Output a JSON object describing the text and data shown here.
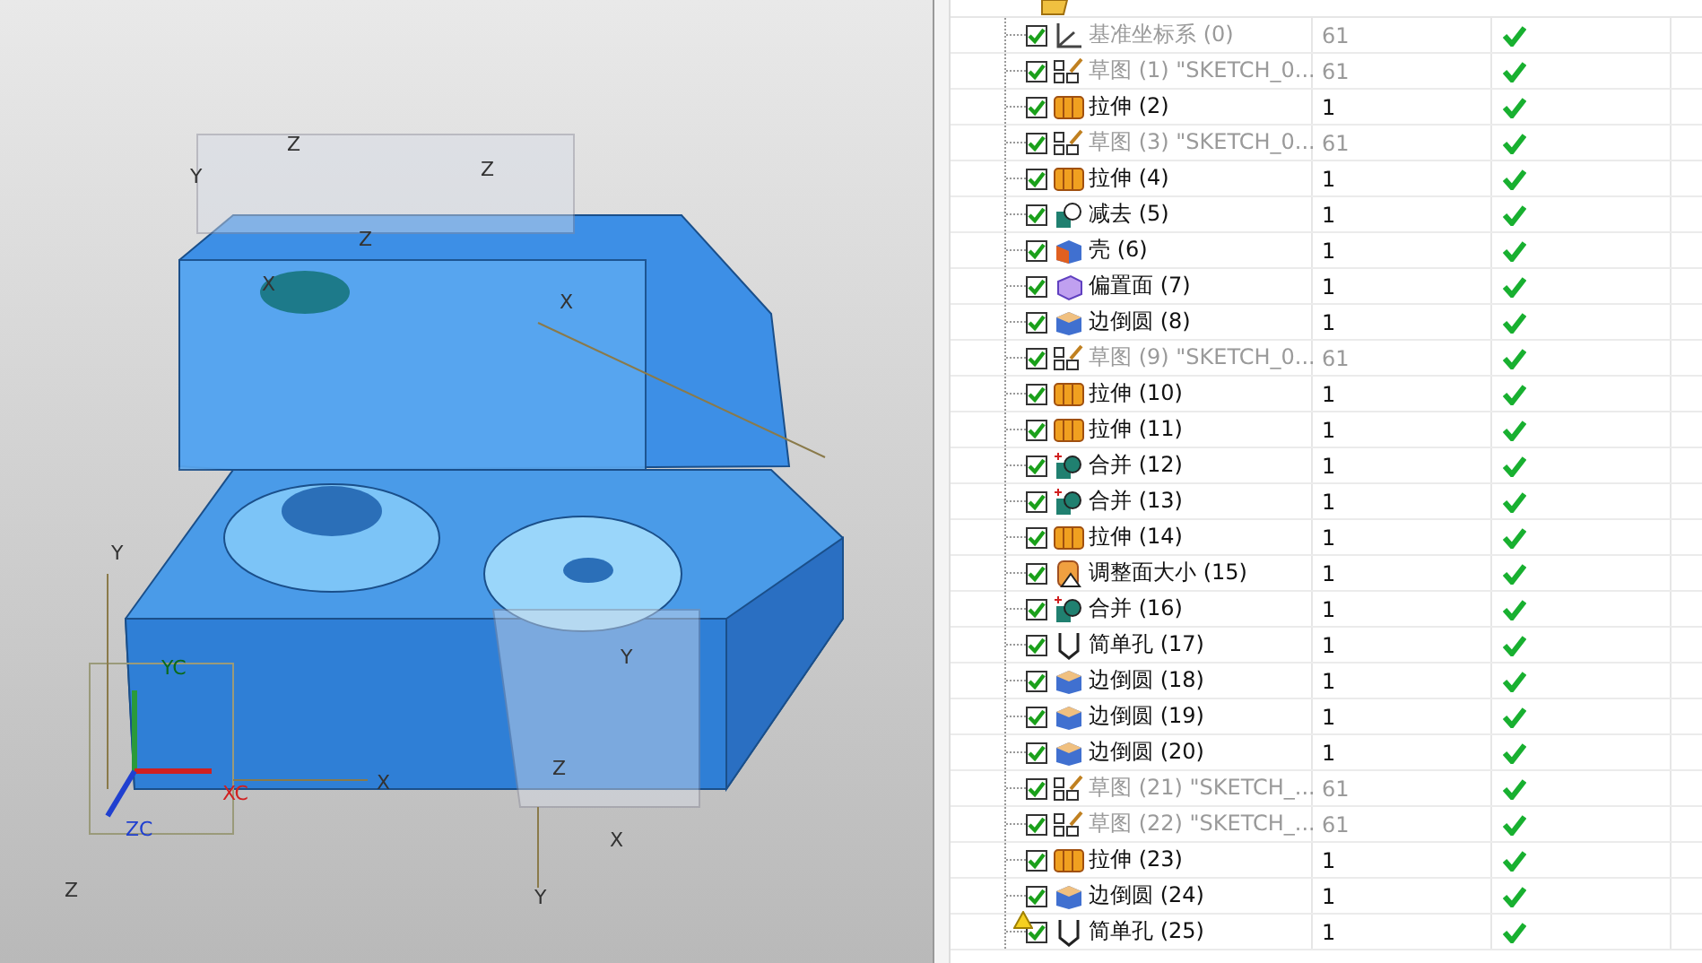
{
  "viewport": {
    "axis_labels": [
      "Z",
      "Y",
      "Z",
      "X",
      "X",
      "Y",
      "YC",
      "XC",
      "ZC",
      "Z",
      "X",
      "Z",
      "Y",
      "X",
      "Y",
      "Z"
    ]
  },
  "part_navigator": {
    "rows": [
      {
        "name": "基准坐标系 (0)",
        "kind": "datum",
        "dimmed": true,
        "checked": true,
        "warning": false,
        "layer": "61",
        "up_to_date": true
      },
      {
        "name": "草图 (1) \"SKETCH_0...",
        "kind": "sketch",
        "dimmed": true,
        "checked": true,
        "warning": false,
        "layer": "61",
        "up_to_date": true
      },
      {
        "name": "拉伸 (2)",
        "kind": "extrude",
        "dimmed": false,
        "checked": true,
        "warning": false,
        "layer": "1",
        "up_to_date": true
      },
      {
        "name": "草图 (3) \"SKETCH_0...",
        "kind": "sketch",
        "dimmed": true,
        "checked": true,
        "warning": false,
        "layer": "61",
        "up_to_date": true
      },
      {
        "name": "拉伸 (4)",
        "kind": "extrude",
        "dimmed": false,
        "checked": true,
        "warning": false,
        "layer": "1",
        "up_to_date": true
      },
      {
        "name": "减去 (5)",
        "kind": "subtract",
        "dimmed": false,
        "checked": true,
        "warning": false,
        "layer": "1",
        "up_to_date": true
      },
      {
        "name": "壳 (6)",
        "kind": "shell",
        "dimmed": false,
        "checked": true,
        "warning": false,
        "layer": "1",
        "up_to_date": true
      },
      {
        "name": "偏置面 (7)",
        "kind": "offset",
        "dimmed": false,
        "checked": true,
        "warning": false,
        "layer": "1",
        "up_to_date": true
      },
      {
        "name": "边倒圆 (8)",
        "kind": "blend",
        "dimmed": false,
        "checked": true,
        "warning": false,
        "layer": "1",
        "up_to_date": true
      },
      {
        "name": "草图 (9) \"SKETCH_0...",
        "kind": "sketch",
        "dimmed": true,
        "checked": true,
        "warning": false,
        "layer": "61",
        "up_to_date": true
      },
      {
        "name": "拉伸 (10)",
        "kind": "extrude",
        "dimmed": false,
        "checked": true,
        "warning": false,
        "layer": "1",
        "up_to_date": true
      },
      {
        "name": "拉伸 (11)",
        "kind": "extrude",
        "dimmed": false,
        "checked": true,
        "warning": false,
        "layer": "1",
        "up_to_date": true
      },
      {
        "name": "合并 (12)",
        "kind": "unite",
        "dimmed": false,
        "checked": true,
        "warning": false,
        "layer": "1",
        "up_to_date": true
      },
      {
        "name": "合并 (13)",
        "kind": "unite",
        "dimmed": false,
        "checked": true,
        "warning": false,
        "layer": "1",
        "up_to_date": true
      },
      {
        "name": "拉伸 (14)",
        "kind": "extrude",
        "dimmed": false,
        "checked": true,
        "warning": false,
        "layer": "1",
        "up_to_date": true
      },
      {
        "name": "调整面大小 (15)",
        "kind": "resize",
        "dimmed": false,
        "checked": true,
        "warning": false,
        "layer": "1",
        "up_to_date": true
      },
      {
        "name": "合并 (16)",
        "kind": "unite",
        "dimmed": false,
        "checked": true,
        "warning": false,
        "layer": "1",
        "up_to_date": true
      },
      {
        "name": "简单孔 (17)",
        "kind": "hole",
        "dimmed": false,
        "checked": true,
        "warning": false,
        "layer": "1",
        "up_to_date": true
      },
      {
        "name": "边倒圆 (18)",
        "kind": "blend",
        "dimmed": false,
        "checked": true,
        "warning": false,
        "layer": "1",
        "up_to_date": true
      },
      {
        "name": "边倒圆 (19)",
        "kind": "blend",
        "dimmed": false,
        "checked": true,
        "warning": false,
        "layer": "1",
        "up_to_date": true
      },
      {
        "name": "边倒圆 (20)",
        "kind": "blend",
        "dimmed": false,
        "checked": true,
        "warning": false,
        "layer": "1",
        "up_to_date": true
      },
      {
        "name": "草图 (21) \"SKETCH_...",
        "kind": "sketch",
        "dimmed": true,
        "checked": true,
        "warning": false,
        "layer": "61",
        "up_to_date": true
      },
      {
        "name": "草图 (22) \"SKETCH_...",
        "kind": "sketch",
        "dimmed": true,
        "checked": true,
        "warning": false,
        "layer": "61",
        "up_to_date": true
      },
      {
        "name": "拉伸 (23)",
        "kind": "extrude",
        "dimmed": false,
        "checked": true,
        "warning": false,
        "layer": "1",
        "up_to_date": true
      },
      {
        "name": "边倒圆 (24)",
        "kind": "blend",
        "dimmed": false,
        "checked": true,
        "warning": false,
        "layer": "1",
        "up_to_date": true
      },
      {
        "name": "简单孔 (25)",
        "kind": "hole",
        "dimmed": false,
        "checked": true,
        "warning": true,
        "layer": "1",
        "up_to_date": true
      }
    ]
  }
}
